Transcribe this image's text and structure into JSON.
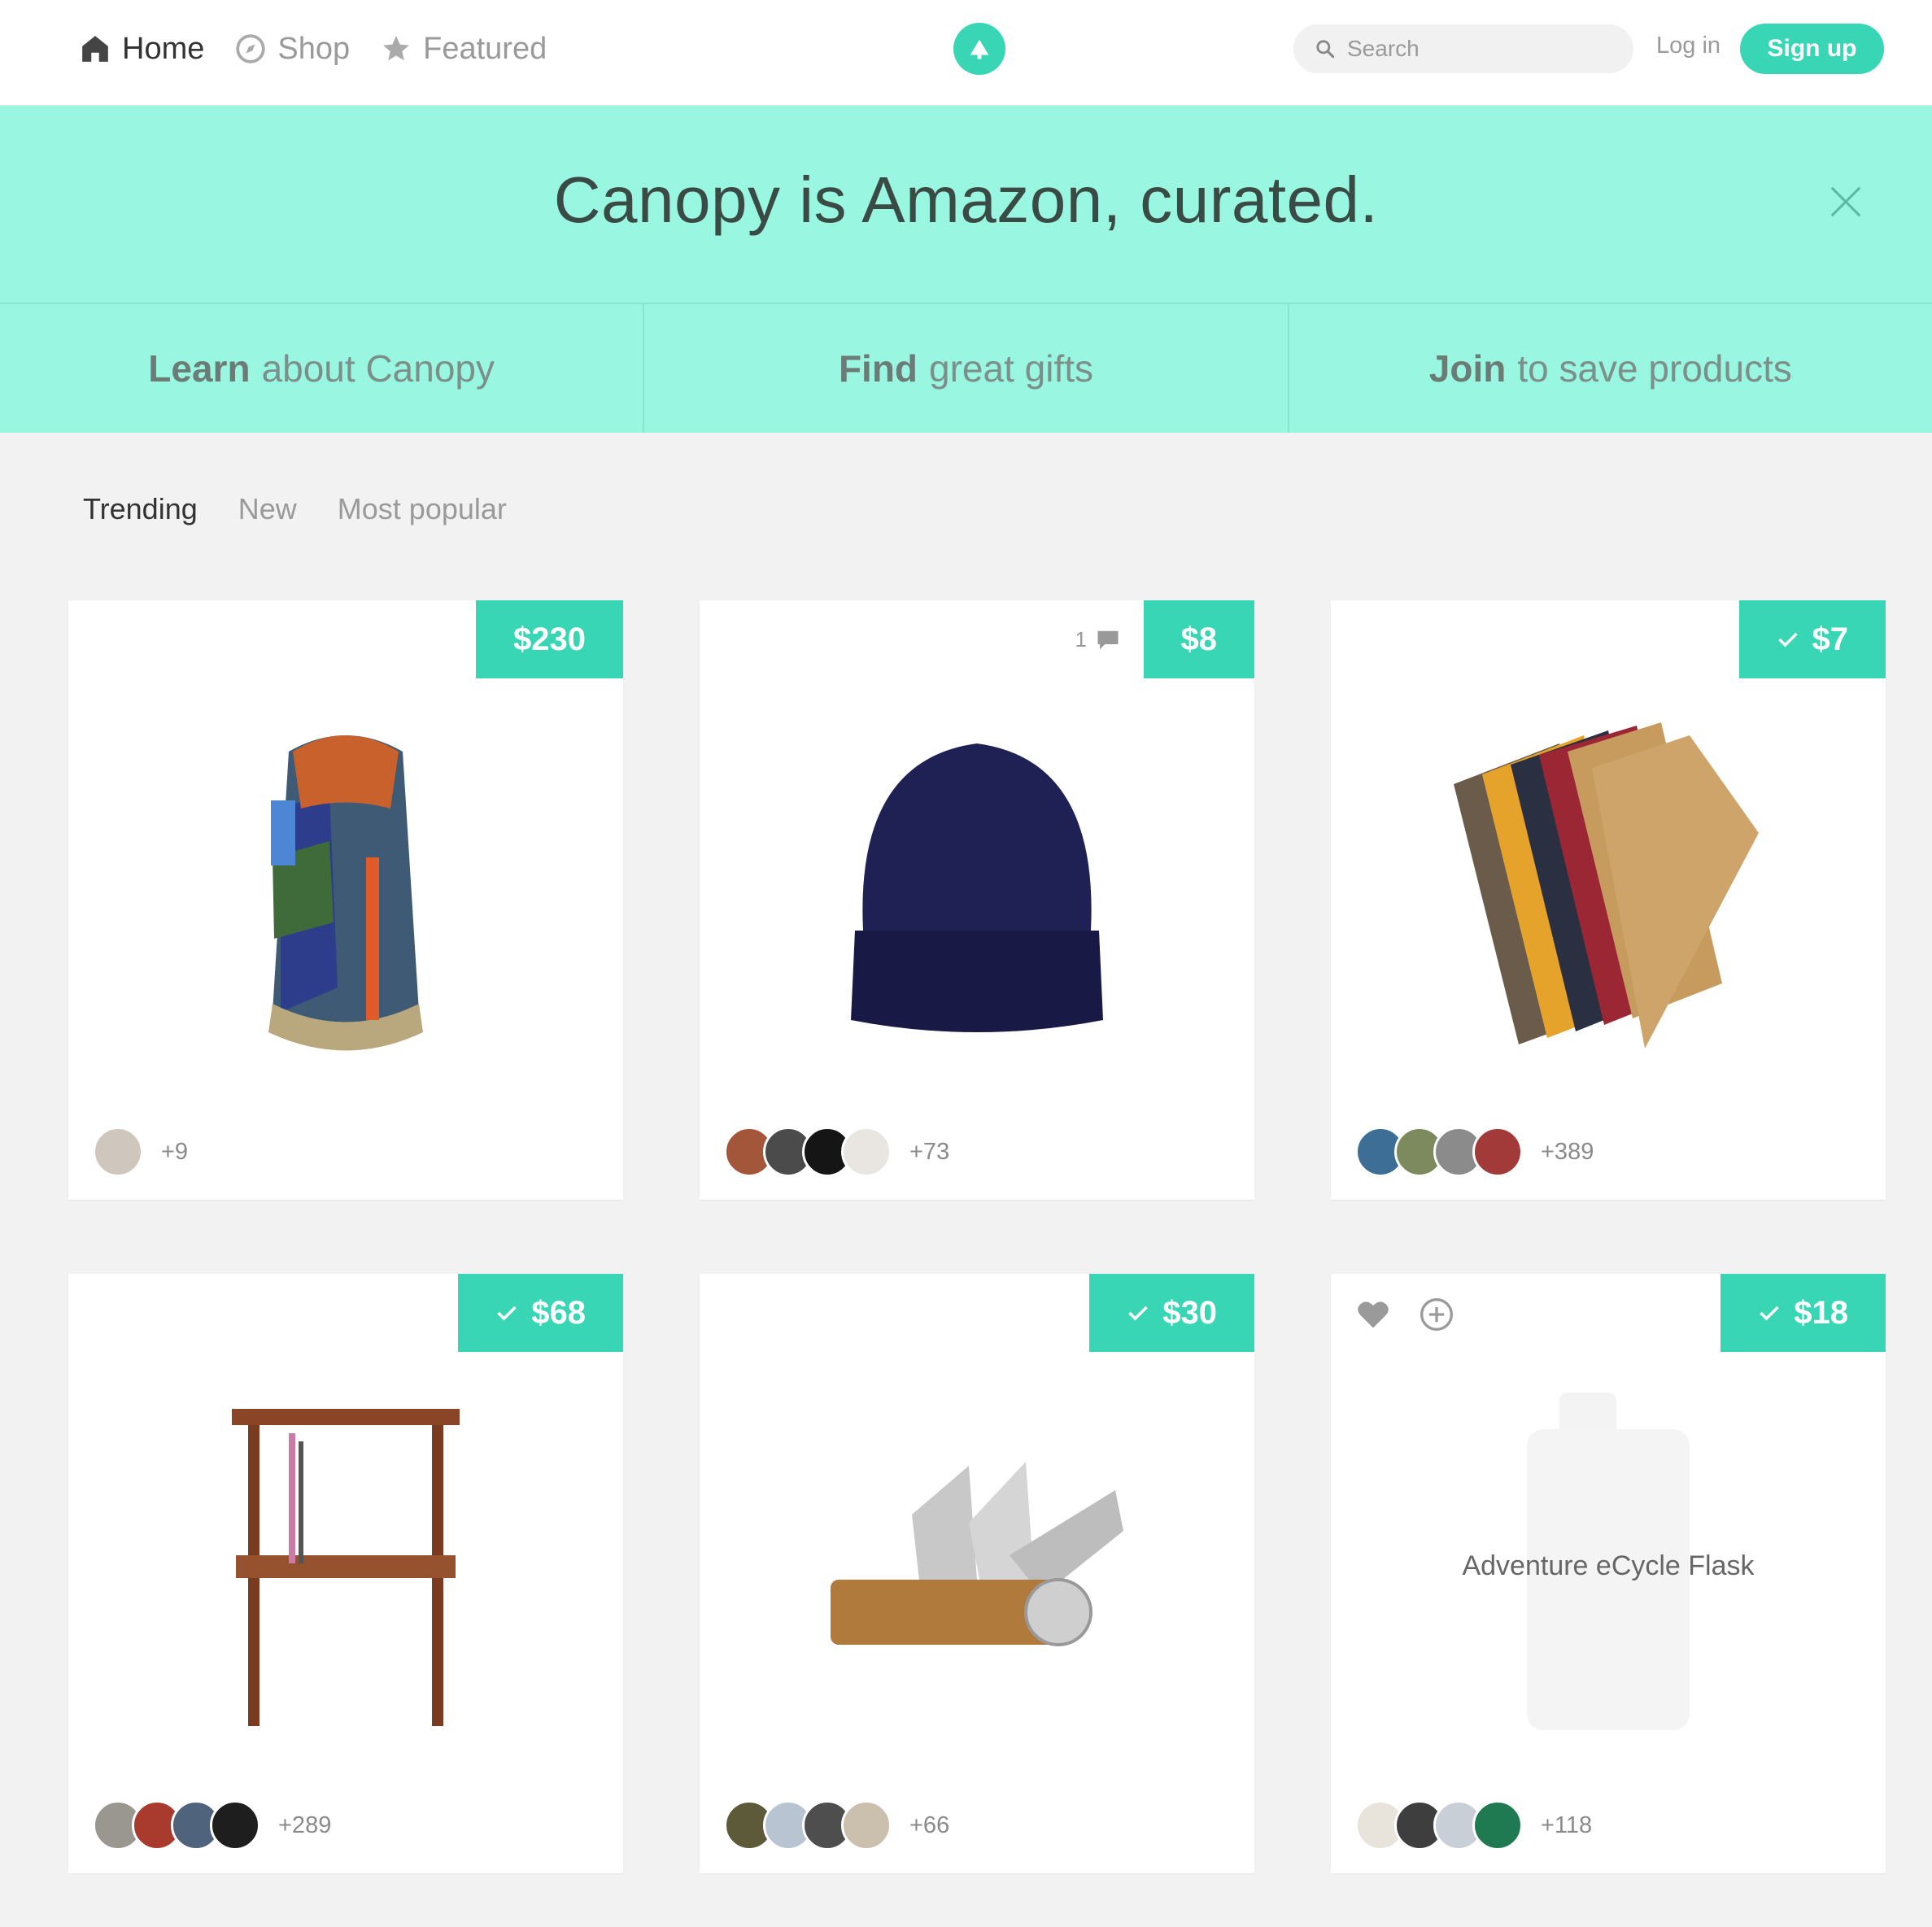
{
  "nav": {
    "links": [
      {
        "label": "Home",
        "icon": "home-icon"
      },
      {
        "label": "Shop",
        "icon": "compass-icon"
      },
      {
        "label": "Featured",
        "icon": "star-icon"
      }
    ],
    "search_placeholder": "Search",
    "login": "Log in",
    "signup": "Sign up"
  },
  "hero": {
    "title": "Canopy is Amazon, curated.",
    "ctas": [
      {
        "strong": "Learn",
        "rest": "about Canopy"
      },
      {
        "strong": "Find",
        "rest": "great gifts"
      },
      {
        "strong": "Join",
        "rest": "to save products"
      }
    ]
  },
  "tabs": [
    "Trending",
    "New",
    "Most popular"
  ],
  "products": [
    {
      "price": "$230",
      "checked": false,
      "comments": null,
      "count": "+9",
      "image": "backpack"
    },
    {
      "price": "$8",
      "checked": false,
      "comments": "1",
      "count": "+73",
      "image": "beanie"
    },
    {
      "price": "$7",
      "checked": true,
      "comments": null,
      "count": "+389",
      "image": "notebooks"
    },
    {
      "price": "$68",
      "checked": true,
      "comments": null,
      "count": "+289",
      "image": "record-stand"
    },
    {
      "price": "$30",
      "checked": true,
      "comments": null,
      "count": "+66",
      "image": "key-organizer"
    },
    {
      "price": "$18",
      "checked": true,
      "comments": null,
      "count": "+118",
      "image": "flask",
      "name": "Adventure eCycle Flask"
    }
  ],
  "colors": {
    "accent": "#38d6b4",
    "banner": "#99f6e0"
  }
}
